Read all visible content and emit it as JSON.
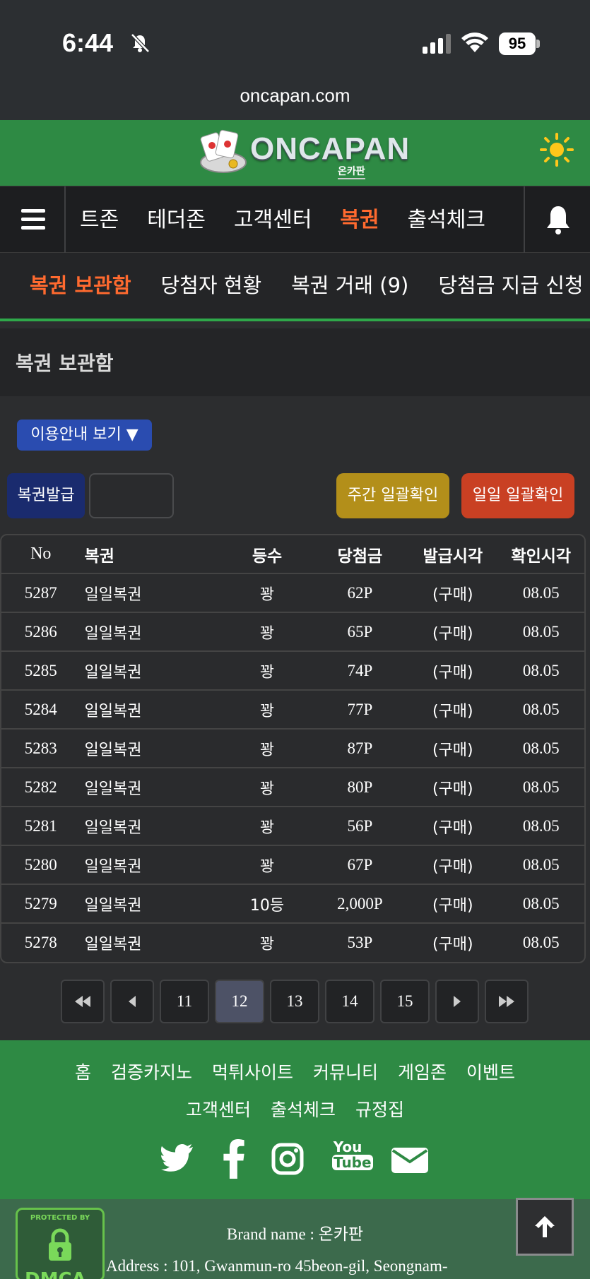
{
  "status_bar": {
    "time": "6:44",
    "battery": "95"
  },
  "browser": {
    "url": "oncapan.com"
  },
  "header": {
    "logo_text": "ONCAPAN",
    "logo_sub": "온카판"
  },
  "nav": {
    "items": [
      {
        "label": "트존",
        "active": false
      },
      {
        "label": "테더존",
        "active": false
      },
      {
        "label": "고객센터",
        "active": false
      },
      {
        "label": "복권",
        "active": true
      },
      {
        "label": "출석체크",
        "active": false
      }
    ]
  },
  "subnav": {
    "items": [
      {
        "label": "복권 보관함",
        "active": true
      },
      {
        "label": "당첨자 현황",
        "active": false
      },
      {
        "label": "복권 거래 (9)",
        "active": false
      },
      {
        "label": "당첨금 지급 신청",
        "active": false
      }
    ]
  },
  "page": {
    "title": "복권 보관함",
    "guide_label": "이용안내 보기 ▼",
    "issue_label": "복권발급",
    "weekly_label": "주간 일괄확인",
    "daily_label": "일일 일괄확인"
  },
  "table": {
    "headers": [
      "No",
      "복권",
      "등수",
      "당첨금",
      "발급시각",
      "확인시각"
    ],
    "rows": [
      [
        "5287",
        "일일복권",
        "꽝",
        "62P",
        "(구매)",
        "08.05"
      ],
      [
        "5286",
        "일일복권",
        "꽝",
        "65P",
        "(구매)",
        "08.05"
      ],
      [
        "5285",
        "일일복권",
        "꽝",
        "74P",
        "(구매)",
        "08.05"
      ],
      [
        "5284",
        "일일복권",
        "꽝",
        "77P",
        "(구매)",
        "08.05"
      ],
      [
        "5283",
        "일일복권",
        "꽝",
        "87P",
        "(구매)",
        "08.05"
      ],
      [
        "5282",
        "일일복권",
        "꽝",
        "80P",
        "(구매)",
        "08.05"
      ],
      [
        "5281",
        "일일복권",
        "꽝",
        "56P",
        "(구매)",
        "08.05"
      ],
      [
        "5280",
        "일일복권",
        "꽝",
        "67P",
        "(구매)",
        "08.05"
      ],
      [
        "5279",
        "일일복권",
        "10등",
        "2,000P",
        "(구매)",
        "08.05"
      ],
      [
        "5278",
        "일일복권",
        "꽝",
        "53P",
        "(구매)",
        "08.05"
      ]
    ]
  },
  "pagination": {
    "pages": [
      "11",
      "12",
      "13",
      "14",
      "15"
    ],
    "current": "12"
  },
  "footer": {
    "links_row1": [
      "홈",
      "검증카지노",
      "먹튀사이트",
      "커뮤니티",
      "게임존",
      "이벤트"
    ],
    "links_row2": [
      "고객센터",
      "출석체크",
      "규정집"
    ],
    "social_icons": [
      "twitter-icon",
      "facebook-icon",
      "instagram-icon",
      "youtube-icon",
      "email-icon"
    ],
    "brand": "Brand name : 온카판",
    "address": "Address : 101, Gwanmun-ro 45beon-gil, Seongnam-",
    "dmca_label": "PROTECTED BY"
  },
  "colors": {
    "accent_orange": "#ff6a2f",
    "header_green": "#2e8a44",
    "weekly_gold": "#b38f1a",
    "daily_red": "#c94023",
    "guide_blue": "#2a4cb0"
  }
}
